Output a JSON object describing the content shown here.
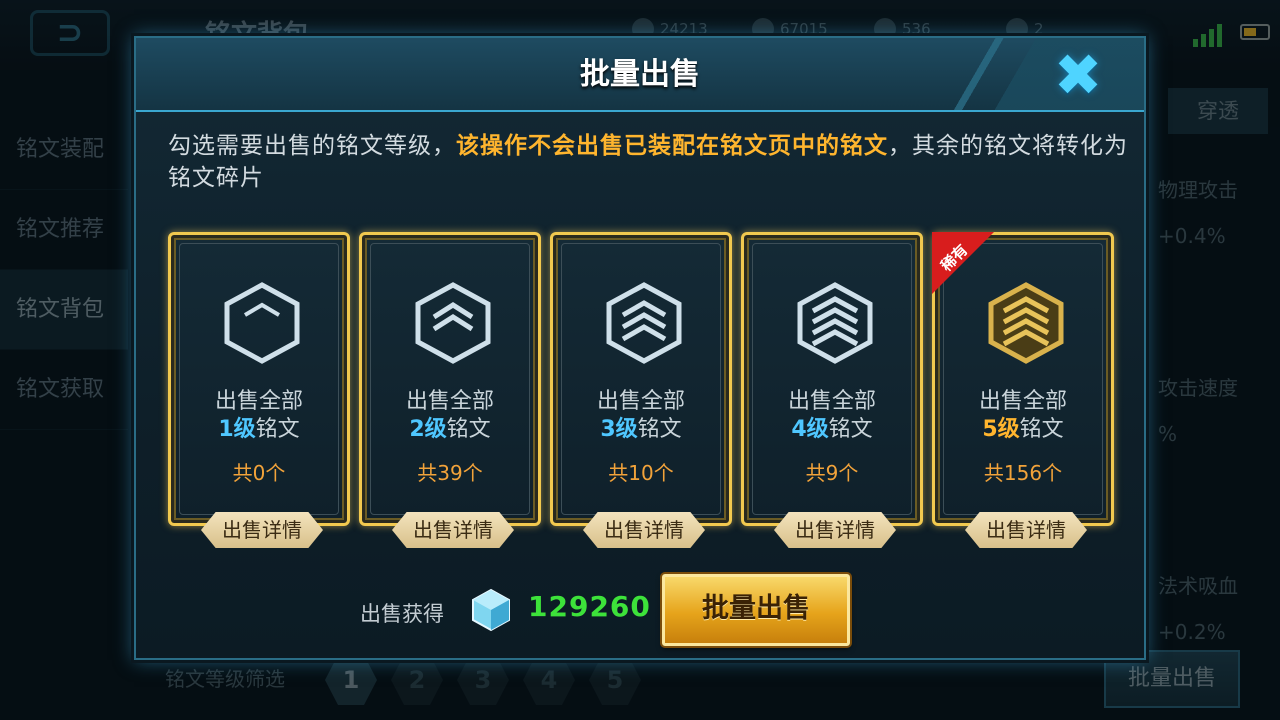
{
  "background": {
    "title": "铭文背包",
    "resources": [
      "24213",
      "67015",
      "536",
      "2"
    ],
    "nav_items": [
      "铭文装配",
      "铭文推荐",
      "铭文背包",
      "铭文获取"
    ],
    "right_tab": "穿透",
    "right_stats": [
      "物理攻击",
      "+0.4%",
      "攻击速度",
      "%",
      "法术吸血",
      "+0.2%"
    ],
    "filter_label": "铭文等级筛选",
    "filter_levels": [
      "1",
      "2",
      "3",
      "4",
      "5"
    ],
    "bottom_sell": "批量出售"
  },
  "modal": {
    "title": "批量出售",
    "desc_part1": "勾选需要出售的铭文等级，",
    "desc_highlight": "该操作不会出售已装配在铭文页中的铭文",
    "desc_part2": "，其余的铭文将转化为铭文碎片",
    "cards": [
      {
        "line1": "出售全部",
        "level": "1级",
        "suffix": "铭文",
        "count": "共0个",
        "detail": "出售详情"
      },
      {
        "line1": "出售全部",
        "level": "2级",
        "suffix": "铭文",
        "count": "共39个",
        "detail": "出售详情"
      },
      {
        "line1": "出售全部",
        "level": "3级",
        "suffix": "铭文",
        "count": "共10个",
        "detail": "出售详情"
      },
      {
        "line1": "出售全部",
        "level": "4级",
        "suffix": "铭文",
        "count": "共9个",
        "detail": "出售详情"
      },
      {
        "line1": "出售全部",
        "level": "5级",
        "suffix": "铭文",
        "count": "共156个",
        "detail": "出售详情",
        "tag": "稀有"
      }
    ],
    "reward_label": "出售获得",
    "reward_value": "129260",
    "sell_button": "批量出售",
    "close_icon": "close-icon"
  },
  "colors": {
    "accent_blue": "#4fc7ff",
    "accent_gold": "#ffb52e",
    "reward_green": "#3de23a",
    "card_border": "#f1c94f",
    "rare_red": "#d81d1d"
  }
}
